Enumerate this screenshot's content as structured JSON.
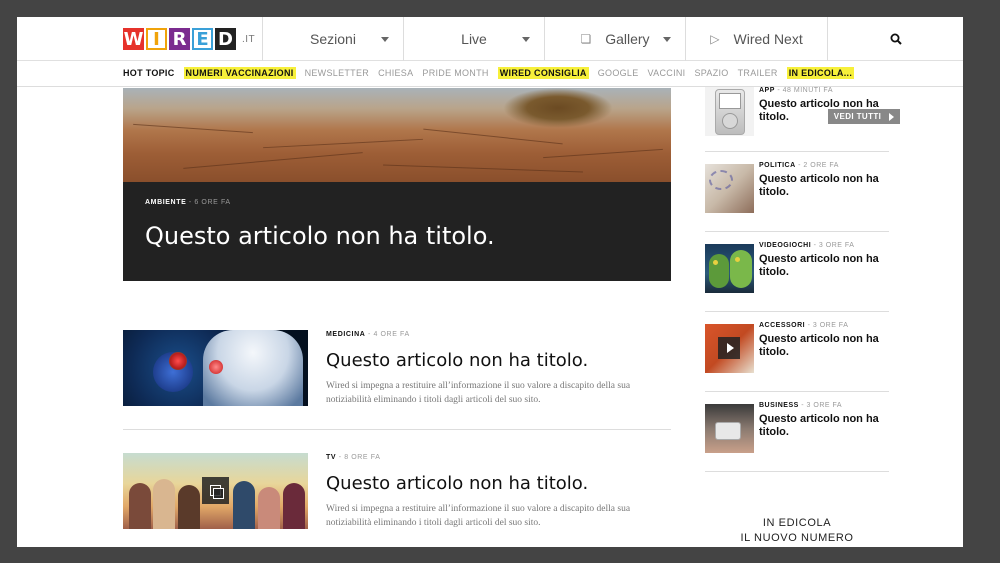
{
  "header": {
    "logo_letters": [
      "W",
      "I",
      "R",
      "E",
      "D"
    ],
    "logo_tld": ".IT",
    "nav": [
      {
        "label": "Sezioni",
        "has_caret": true
      },
      {
        "label": "Live",
        "has_caret": true
      },
      {
        "label": "Gallery",
        "has_caret": true,
        "icon": "gallery-icon"
      },
      {
        "label": "Wired Next",
        "has_caret": false,
        "icon": "play-outline-icon"
      }
    ],
    "search_icon": "search-icon"
  },
  "topics": {
    "hot_label": "HOT TOPIC",
    "items": [
      {
        "label": "NUMERI VACCINAZIONI",
        "highlight": true
      },
      {
        "label": "NEWSLETTER",
        "highlight": false
      },
      {
        "label": "CHIESA",
        "highlight": false
      },
      {
        "label": "PRIDE MONTH",
        "highlight": false
      },
      {
        "label": "WIRED CONSIGLIA",
        "highlight": true
      },
      {
        "label": "GOOGLE",
        "highlight": false
      },
      {
        "label": "VACCINI",
        "highlight": false
      },
      {
        "label": "SPAZIO",
        "highlight": false
      },
      {
        "label": "TRAILER",
        "highlight": false
      },
      {
        "label": "IN EDICOLA...",
        "highlight": true
      }
    ],
    "vedi_tutti": "VEDI TUTTI",
    "highlight_color": "#f7f03a"
  },
  "hero": {
    "category": "AMBIENTE",
    "time": "6 ORE FA",
    "title": "Questo articolo non ha titolo."
  },
  "articles": [
    {
      "category": "MEDICINA",
      "time": "4 ORE FA",
      "title": "Questo articolo non ha titolo.",
      "desc": "Wired si impegna a restituire all’informazione il suo valore a discapito della sua notiziabilità eliminando i titoli dagli articoli del suo sito."
    },
    {
      "category": "TV",
      "time": "8 ORE FA",
      "title": "Questo articolo non ha titolo.",
      "desc": "Wired si impegna a restituire all’informazione il suo valore a discapito della sua notiziabilità eliminando i titoli dagli articoli del suo sito."
    }
  ],
  "sidebar": [
    {
      "category": "APP",
      "time": "48 MINUTI FA",
      "title": "Questo articolo non ha titolo."
    },
    {
      "category": "POLITICA",
      "time": "2 ORE FA",
      "title": "Questo articolo non ha titolo."
    },
    {
      "category": "VIDEOGIOCHI",
      "time": "3 ORE FA",
      "title": "Questo articolo non ha titolo."
    },
    {
      "category": "ACCESSORI",
      "time": "3 ORE FA",
      "title": "Questo articolo non ha titolo."
    },
    {
      "category": "BUSINESS",
      "time": "3 ORE FA",
      "title": "Questo articolo non ha titolo."
    }
  ],
  "edicola": {
    "line1": "IN EDICOLA",
    "line2": "IL NUOVO NUMERO"
  },
  "separator": " - "
}
